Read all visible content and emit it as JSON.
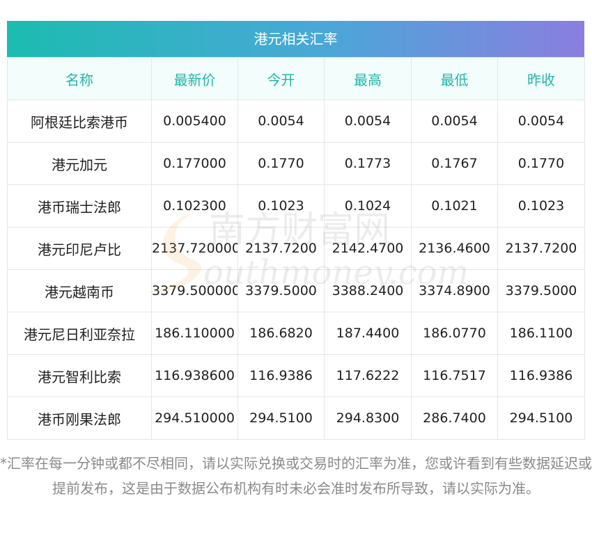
{
  "title": "港元相关汇率",
  "columns": [
    "名称",
    "最新价",
    "今开",
    "最高",
    "最低",
    "昨收"
  ],
  "rows": [
    [
      "阿根廷比索港币",
      "0.005400",
      "0.0054",
      "0.0054",
      "0.0054",
      "0.0054"
    ],
    [
      "港元加元",
      "0.177000",
      "0.1770",
      "0.1773",
      "0.1767",
      "0.1770"
    ],
    [
      "港币瑞士法郎",
      "0.102300",
      "0.1023",
      "0.1024",
      "0.1021",
      "0.1023"
    ],
    [
      "港元印尼卢比",
      "2137.720000",
      "2137.7200",
      "2142.4700",
      "2136.4600",
      "2137.7200"
    ],
    [
      "港元越南币",
      "3379.500000",
      "3379.5000",
      "3388.2400",
      "3374.8900",
      "3379.5000"
    ],
    [
      "港元尼日利亚奈拉",
      "186.110000",
      "186.6820",
      "187.4400",
      "186.0770",
      "186.1100"
    ],
    [
      "港元智利比索",
      "116.938600",
      "116.9386",
      "117.6222",
      "116.7517",
      "116.9386"
    ],
    [
      "港币刚果法郎",
      "294.510000",
      "294.5100",
      "294.8300",
      "286.7400",
      "294.5100"
    ]
  ],
  "watermark": {
    "cn": "南方财富网",
    "en": "outhmoney.com"
  },
  "note": "*汇率在每一分钟或都不尽相同，请以实际兑换或交易时的汇率为准，您或许看到有些数据延迟或提前发布，这是由于数据公布机构有时未必会准时发布所导致，请以实际为准。",
  "colors": {
    "header_text": "#21b7a7",
    "header_bg": "#f2fdfc",
    "grad_start": "#1cbcb0",
    "grad_end": "#8b7ee0"
  }
}
